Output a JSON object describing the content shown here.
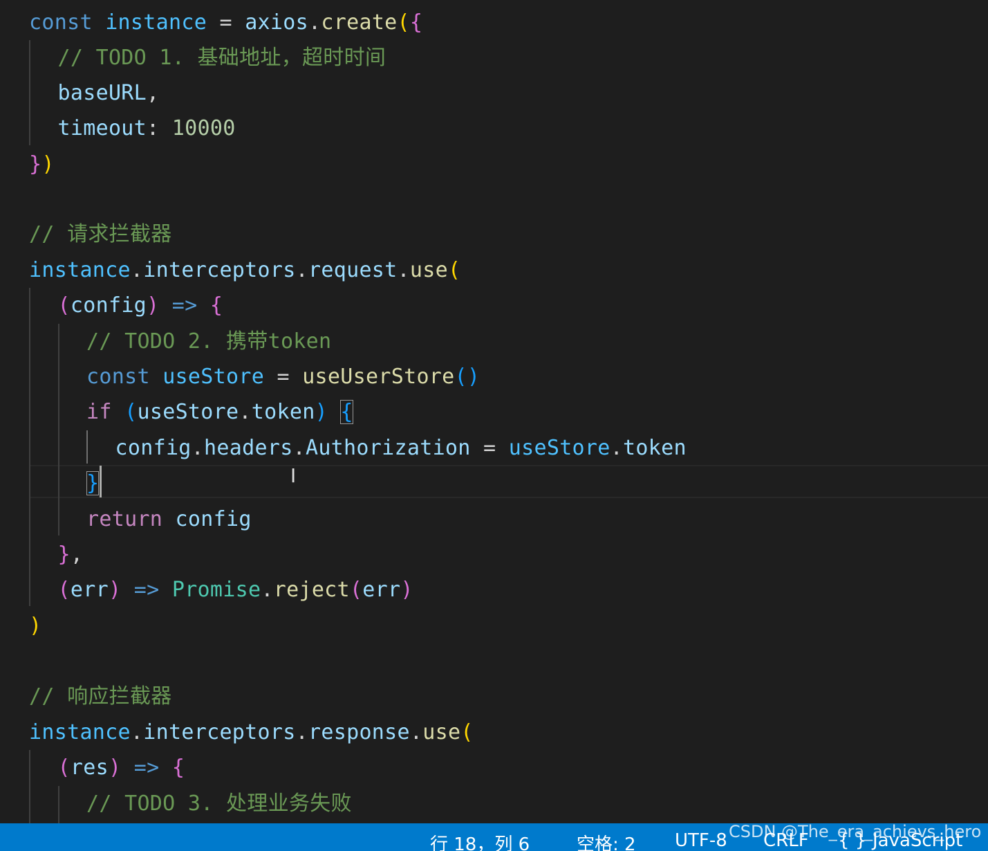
{
  "editor": {
    "language": "JavaScript",
    "cursor_line_index": 13,
    "lines": [
      {
        "tokens": [
          {
            "t": "const",
            "c": "kw"
          },
          {
            "t": " "
          },
          {
            "t": "instance",
            "c": "var"
          },
          {
            "t": " = ",
            "c": "op"
          },
          {
            "t": "axios",
            "c": "id"
          },
          {
            "t": ".",
            "c": "op"
          },
          {
            "t": "create",
            "c": "fn"
          },
          {
            "t": "(",
            "c": "p1"
          },
          {
            "t": "{",
            "c": "p2"
          }
        ]
      },
      {
        "tokens": [
          {
            "t": "// TODO 1. 基础地址，超时时间",
            "c": "cm"
          }
        ]
      },
      {
        "tokens": [
          {
            "t": "baseURL",
            "c": "id"
          },
          {
            "t": ",",
            "c": "op"
          }
        ]
      },
      {
        "tokens": [
          {
            "t": "timeout",
            "c": "id"
          },
          {
            "t": ": ",
            "c": "op"
          },
          {
            "t": "10000",
            "c": "num"
          }
        ]
      },
      {
        "tokens": [
          {
            "t": "}",
            "c": "p2"
          },
          {
            "t": ")",
            "c": "p1"
          }
        ]
      },
      {
        "tokens": []
      },
      {
        "tokens": [
          {
            "t": "// 请求拦截器",
            "c": "cm"
          }
        ]
      },
      {
        "tokens": [
          {
            "t": "instance",
            "c": "var"
          },
          {
            "t": ".",
            "c": "op"
          },
          {
            "t": "interceptors",
            "c": "id"
          },
          {
            "t": ".",
            "c": "op"
          },
          {
            "t": "request",
            "c": "id"
          },
          {
            "t": ".",
            "c": "op"
          },
          {
            "t": "use",
            "c": "fn"
          },
          {
            "t": "(",
            "c": "p1"
          }
        ]
      },
      {
        "tokens": [
          {
            "t": "(",
            "c": "p2"
          },
          {
            "t": "config",
            "c": "id"
          },
          {
            "t": ")",
            "c": "p2"
          },
          {
            "t": " "
          },
          {
            "t": "=>",
            "c": "kw"
          },
          {
            "t": " "
          },
          {
            "t": "{",
            "c": "p2"
          }
        ]
      },
      {
        "tokens": [
          {
            "t": "// TODO 2. 携带token",
            "c": "cm"
          }
        ]
      },
      {
        "tokens": [
          {
            "t": "const",
            "c": "kw"
          },
          {
            "t": " "
          },
          {
            "t": "useStore",
            "c": "var"
          },
          {
            "t": " = ",
            "c": "op"
          },
          {
            "t": "useUserStore",
            "c": "fn"
          },
          {
            "t": "()",
            "c": "p3"
          }
        ]
      },
      {
        "tokens": [
          {
            "t": "if",
            "c": "kw2"
          },
          {
            "t": " "
          },
          {
            "t": "(",
            "c": "p3"
          },
          {
            "t": "useStore",
            "c": "id"
          },
          {
            "t": ".",
            "c": "op"
          },
          {
            "t": "token",
            "c": "id"
          },
          {
            "t": ")",
            "c": "p3"
          },
          {
            "t": " "
          },
          {
            "t": "{",
            "c": "p3",
            "m": true
          }
        ]
      },
      {
        "tokens": [
          {
            "t": "config",
            "c": "id"
          },
          {
            "t": ".",
            "c": "op"
          },
          {
            "t": "headers",
            "c": "id"
          },
          {
            "t": ".",
            "c": "op"
          },
          {
            "t": "Authorization",
            "c": "id"
          },
          {
            "t": " = ",
            "c": "op"
          },
          {
            "t": "useStore",
            "c": "var"
          },
          {
            "t": ".",
            "c": "op"
          },
          {
            "t": "token",
            "c": "id"
          }
        ]
      },
      {
        "tokens": [
          {
            "t": "}",
            "c": "p3",
            "m": true
          }
        ]
      },
      {
        "tokens": [
          {
            "t": "return",
            "c": "kw2"
          },
          {
            "t": " "
          },
          {
            "t": "config",
            "c": "id"
          }
        ]
      },
      {
        "tokens": [
          {
            "t": "}",
            "c": "p2"
          },
          {
            "t": ",",
            "c": "op"
          }
        ]
      },
      {
        "tokens": [
          {
            "t": "(",
            "c": "p2"
          },
          {
            "t": "err",
            "c": "id"
          },
          {
            "t": ")",
            "c": "p2"
          },
          {
            "t": " "
          },
          {
            "t": "=>",
            "c": "kw"
          },
          {
            "t": " "
          },
          {
            "t": "Promise",
            "c": "cls"
          },
          {
            "t": ".",
            "c": "op"
          },
          {
            "t": "reject",
            "c": "fn"
          },
          {
            "t": "(",
            "c": "p2"
          },
          {
            "t": "err",
            "c": "id"
          },
          {
            "t": ")",
            "c": "p2"
          }
        ]
      },
      {
        "tokens": [
          {
            "t": ")",
            "c": "p1"
          }
        ]
      },
      {
        "tokens": []
      },
      {
        "tokens": [
          {
            "t": "// 响应拦截器",
            "c": "cm"
          }
        ]
      },
      {
        "tokens": [
          {
            "t": "instance",
            "c": "var"
          },
          {
            "t": ".",
            "c": "op"
          },
          {
            "t": "interceptors",
            "c": "id"
          },
          {
            "t": ".",
            "c": "op"
          },
          {
            "t": "response",
            "c": "id"
          },
          {
            "t": ".",
            "c": "op"
          },
          {
            "t": "use",
            "c": "fn"
          },
          {
            "t": "(",
            "c": "p1"
          }
        ]
      },
      {
        "tokens": [
          {
            "t": "(",
            "c": "p2"
          },
          {
            "t": "res",
            "c": "id"
          },
          {
            "t": ")",
            "c": "p2"
          },
          {
            "t": " "
          },
          {
            "t": "=>",
            "c": "kw"
          },
          {
            "t": " "
          },
          {
            "t": "{",
            "c": "p2"
          }
        ]
      },
      {
        "tokens": [
          {
            "t": "// TODO 3. 处理业务失败",
            "c": "cm"
          }
        ]
      }
    ]
  },
  "statusbar": {
    "position": "行 18，列 6",
    "indent": "空格: 2",
    "encoding": "UTF-8",
    "eol": "CRLF",
    "language_icon": "braces-icon",
    "language_icon_glyph": "{ }",
    "language": "JavaScript",
    "background": "#007acc"
  },
  "watermark": "CSDN @The_era_achievs_hero"
}
